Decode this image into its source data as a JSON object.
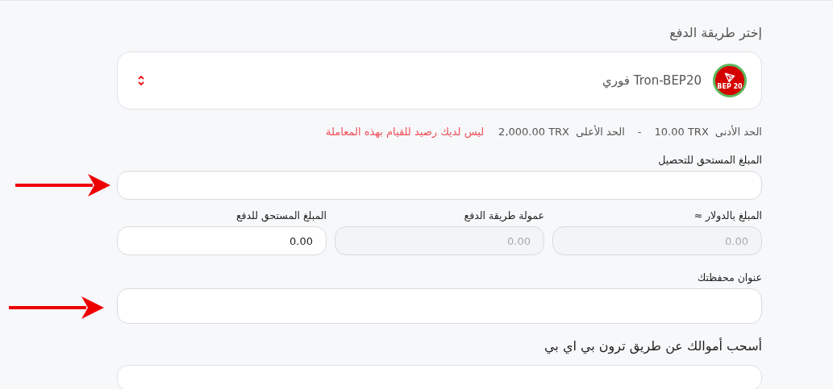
{
  "method_label": "إختر طريقة الدفع",
  "select": {
    "value": "Tron-BEP20 فوري",
    "logo_text": "BEP 20"
  },
  "limits": {
    "min_label": "الحد الأدنى",
    "min_value": "10.00 TRX",
    "separator": "-",
    "max_label": "الحد الأعلى",
    "max_value": "2,000.00 TRX",
    "error": "ليس لديك رصيد للقيام بهذه المعاملة"
  },
  "amount_field": {
    "label": "المبلغ المستحق للتحصيل",
    "arrow": true
  },
  "summary_fields": [
    {
      "label": "المبلغ بالدولار ≈",
      "value": "0.00",
      "disabled": true
    },
    {
      "label": "عمولة طريقة الدفع",
      "value": "0.00",
      "disabled": true
    },
    {
      "label": "المبلغ المستحق للدفع",
      "value": "0.00",
      "disabled": false
    }
  ],
  "wallet_field": {
    "label": "عنوان محفظتك",
    "arrow": true
  },
  "withdraw_heading": "أسحب أموالك عن طريق ترون بي اي بي"
}
